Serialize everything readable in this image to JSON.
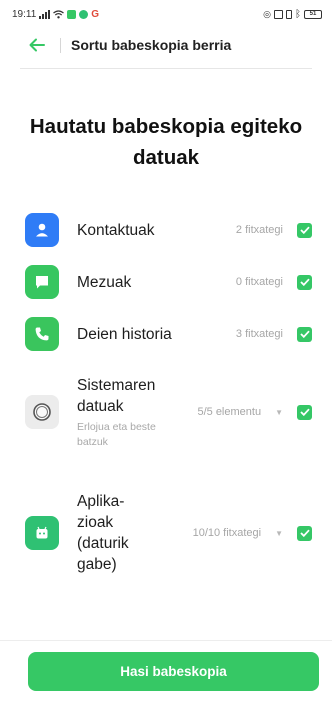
{
  "status_bar": {
    "time": "19:11",
    "battery": "51"
  },
  "header": {
    "title": "Sortu babeskopia berria"
  },
  "heading": "Hautatu babeskopia egiteko datuak",
  "items": [
    {
      "label": "Kontaktuak",
      "count": "2 fitxategi",
      "icon": "contacts-icon",
      "checked": true
    },
    {
      "label": "Mezuak",
      "count": "0 fitxategi",
      "icon": "messages-icon",
      "checked": true
    },
    {
      "label": "Deien historia",
      "count": "3 fitxategi",
      "icon": "phone-icon",
      "checked": true
    },
    {
      "label": "Sistemaren datuak",
      "sublabel": "Erlojua eta beste batzuk",
      "count": "5/5 elementu",
      "icon": "system-icon",
      "checked": true,
      "expandable": true
    },
    {
      "label": "Aplika-zioak (daturik gabe)",
      "count": "10/10 fitxategi",
      "icon": "apps-icon",
      "checked": true,
      "expandable": true
    }
  ],
  "footer": {
    "button_label": "Hasi babeskopia"
  },
  "colors": {
    "accent": "#36c865",
    "contacts": "#2f7cf6"
  }
}
